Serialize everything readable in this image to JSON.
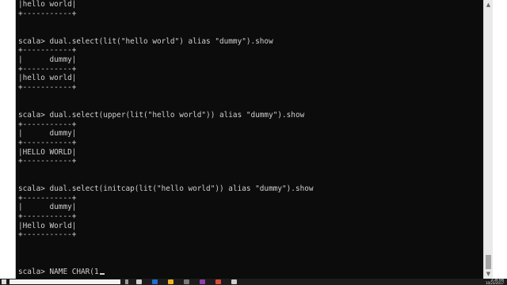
{
  "terminal": {
    "lines": [
      "|hello world|",
      "+-----------+",
      "",
      "",
      "scala> dual.select(lit(\"hello world\") alias \"dummy\").show",
      "+-----------+",
      "|      dummy|",
      "+-----------+",
      "|hello world|",
      "+-----------+",
      "",
      "",
      "scala> dual.select(upper(lit(\"hello world\")) alias \"dummy\").show",
      "+-----------+",
      "|      dummy|",
      "+-----------+",
      "|HELLO WORLD|",
      "+-----------+",
      "",
      "",
      "scala> dual.select(initcap(lit(\"hello world\")) alias \"dummy\").show",
      "+-----------+",
      "|      dummy|",
      "+-----------+",
      "|Hello World|",
      "+-----------+",
      "",
      "",
      ""
    ],
    "current_input": "scala> NAME CHAR(1"
  },
  "taskbar": {
    "clock_time": "3:39 AM",
    "clock_date": "10/23/2017",
    "icons": [
      {
        "name": "task-view-icon",
        "color": "#d0d0d0"
      },
      {
        "name": "edge-icon",
        "color": "#1f6fd1"
      },
      {
        "name": "file-explorer-icon",
        "color": "#e8b423"
      },
      {
        "name": "store-icon",
        "color": "#7a7a7a"
      },
      {
        "name": "onenote-icon",
        "color": "#8b3fa8"
      },
      {
        "name": "chrome-icon",
        "color": "#d84b3a"
      },
      {
        "name": "app-icon",
        "color": "#cfcfcf"
      }
    ]
  }
}
